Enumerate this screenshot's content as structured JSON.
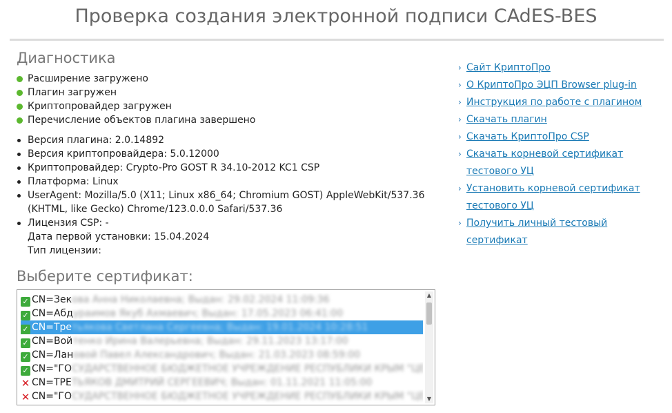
{
  "page": {
    "title": "Проверка создания электронной подписи CAdES-BES"
  },
  "diagnostics": {
    "heading": "Диагностика",
    "status": [
      "Расширение загружено",
      "Плагин загружен",
      "Криптопровайдер загружен",
      "Перечисление объектов плагина завершено"
    ],
    "info": [
      "Версия плагина: 2.0.14892",
      "Версия криптопровайдера: 5.0.12000",
      "Криптопровайдер: Crypto-Pro GOST R 34.10-2012 KC1 CSP",
      "Платформа: Linux",
      "UserAgent: Mozilla/5.0 (X11; Linux x86_64; Chromium GOST) AppleWebKit/537.36 (KHTML, like Gecko) Chrome/123.0.0.0 Safari/537.36",
      "Лицензия CSP: -\nДата первой установки: 15.04.2024\nТип лицензии:"
    ]
  },
  "certificates": {
    "heading": "Выберите сертификат:",
    "selected_index": 2,
    "items": [
      {
        "valid": true,
        "prefix": "CN=Зек",
        "obscured": "ова Анна Николаевна; Выдан: 29.02.2024 11:09:36"
      },
      {
        "valid": true,
        "prefix": "CN=Абд",
        "obscured": "ураимов Якуб Ахмаевич; Выдан: 17.05.2023 06:41:00"
      },
      {
        "valid": true,
        "prefix": "CN=Тре",
        "obscured": "тьякова Светлана Сергеевна; Выдан: 19.01.2024 10:28:51"
      },
      {
        "valid": true,
        "prefix": "CN=Вой",
        "obscured": "тенко Ирина Валерьевна; Выдан: 29.11.2023 13:17:00"
      },
      {
        "valid": true,
        "prefix": "CN=Лан",
        "obscured": "овой Павел Александрович; Выдан: 21.03.2023 08:59:00"
      },
      {
        "valid": true,
        "prefix": "CN=\"ГО",
        "obscured": "СУДАРСТВЕННОЕ БЮДЖЕТНОЕ УЧРЕЖДЕНИЕ РЕСПУБЛИКИ КРЫМ \"ЦЕЛОТ"
      },
      {
        "valid": false,
        "prefix": "CN=ТРЕ",
        "obscured": "ТЬЯКОВ ДМИТРИЙ СЕРГЕЕВИЧ; Выдан: 01.11.2021 11:05:00"
      },
      {
        "valid": false,
        "prefix": "CN=\"ГО",
        "obscured": "СУДАРСТВЕННОЕ БЮДЖЕТНОЕ УЧРЕЖДЕНИЕ РЕСПУБЛИКИ КРЫМ \"ЦЕЛОТ"
      }
    ]
  },
  "links": [
    "Сайт КриптоПро",
    "О КриптоПро ЭЦП Browser plug-in",
    "Инструкция по работе с плагином",
    "Скачать плагин",
    "Скачать КриптоПро CSP",
    "Скачать корневой сертификат тестового УЦ",
    "Установить корневой сертификат тестового УЦ",
    "Получить личный тестовый сертификат"
  ],
  "colors": {
    "status_ok": "#5cb82f",
    "link": "#1a7ab5",
    "selection": "#3ea0e6",
    "invalid_mark": "#d8232a"
  }
}
